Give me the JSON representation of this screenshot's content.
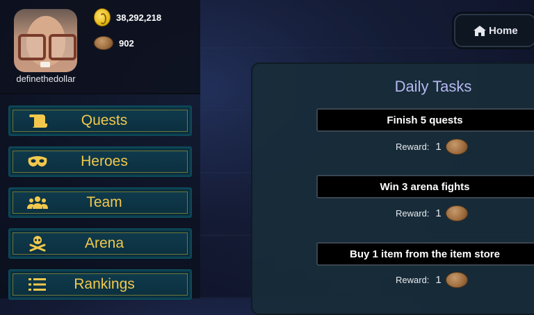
{
  "profile": {
    "username": "definethedollar",
    "coins": "38,292,218",
    "cookies": "902"
  },
  "nav": {
    "items": [
      {
        "label": "Quests",
        "icon": "scroll-icon"
      },
      {
        "label": "Heroes",
        "icon": "mask-icon"
      },
      {
        "label": "Team",
        "icon": "users-icon"
      },
      {
        "label": "Arena",
        "icon": "skull-crossbones-icon"
      },
      {
        "label": "Rankings",
        "icon": "list-icon"
      }
    ]
  },
  "header": {
    "home_label": "Home"
  },
  "daily_tasks": {
    "title": "Daily Tasks",
    "reward_label": "Reward:",
    "tasks": [
      {
        "name": "Finish 5 quests",
        "reward": "1"
      },
      {
        "name": "Win 3 arena fights",
        "reward": "1"
      },
      {
        "name": "Buy 1 item from the item store",
        "reward": "1"
      }
    ]
  },
  "colors": {
    "nav_text": "#f2c94c",
    "panel_title": "#b7b8f0",
    "panel_bg": "#182d3a"
  }
}
